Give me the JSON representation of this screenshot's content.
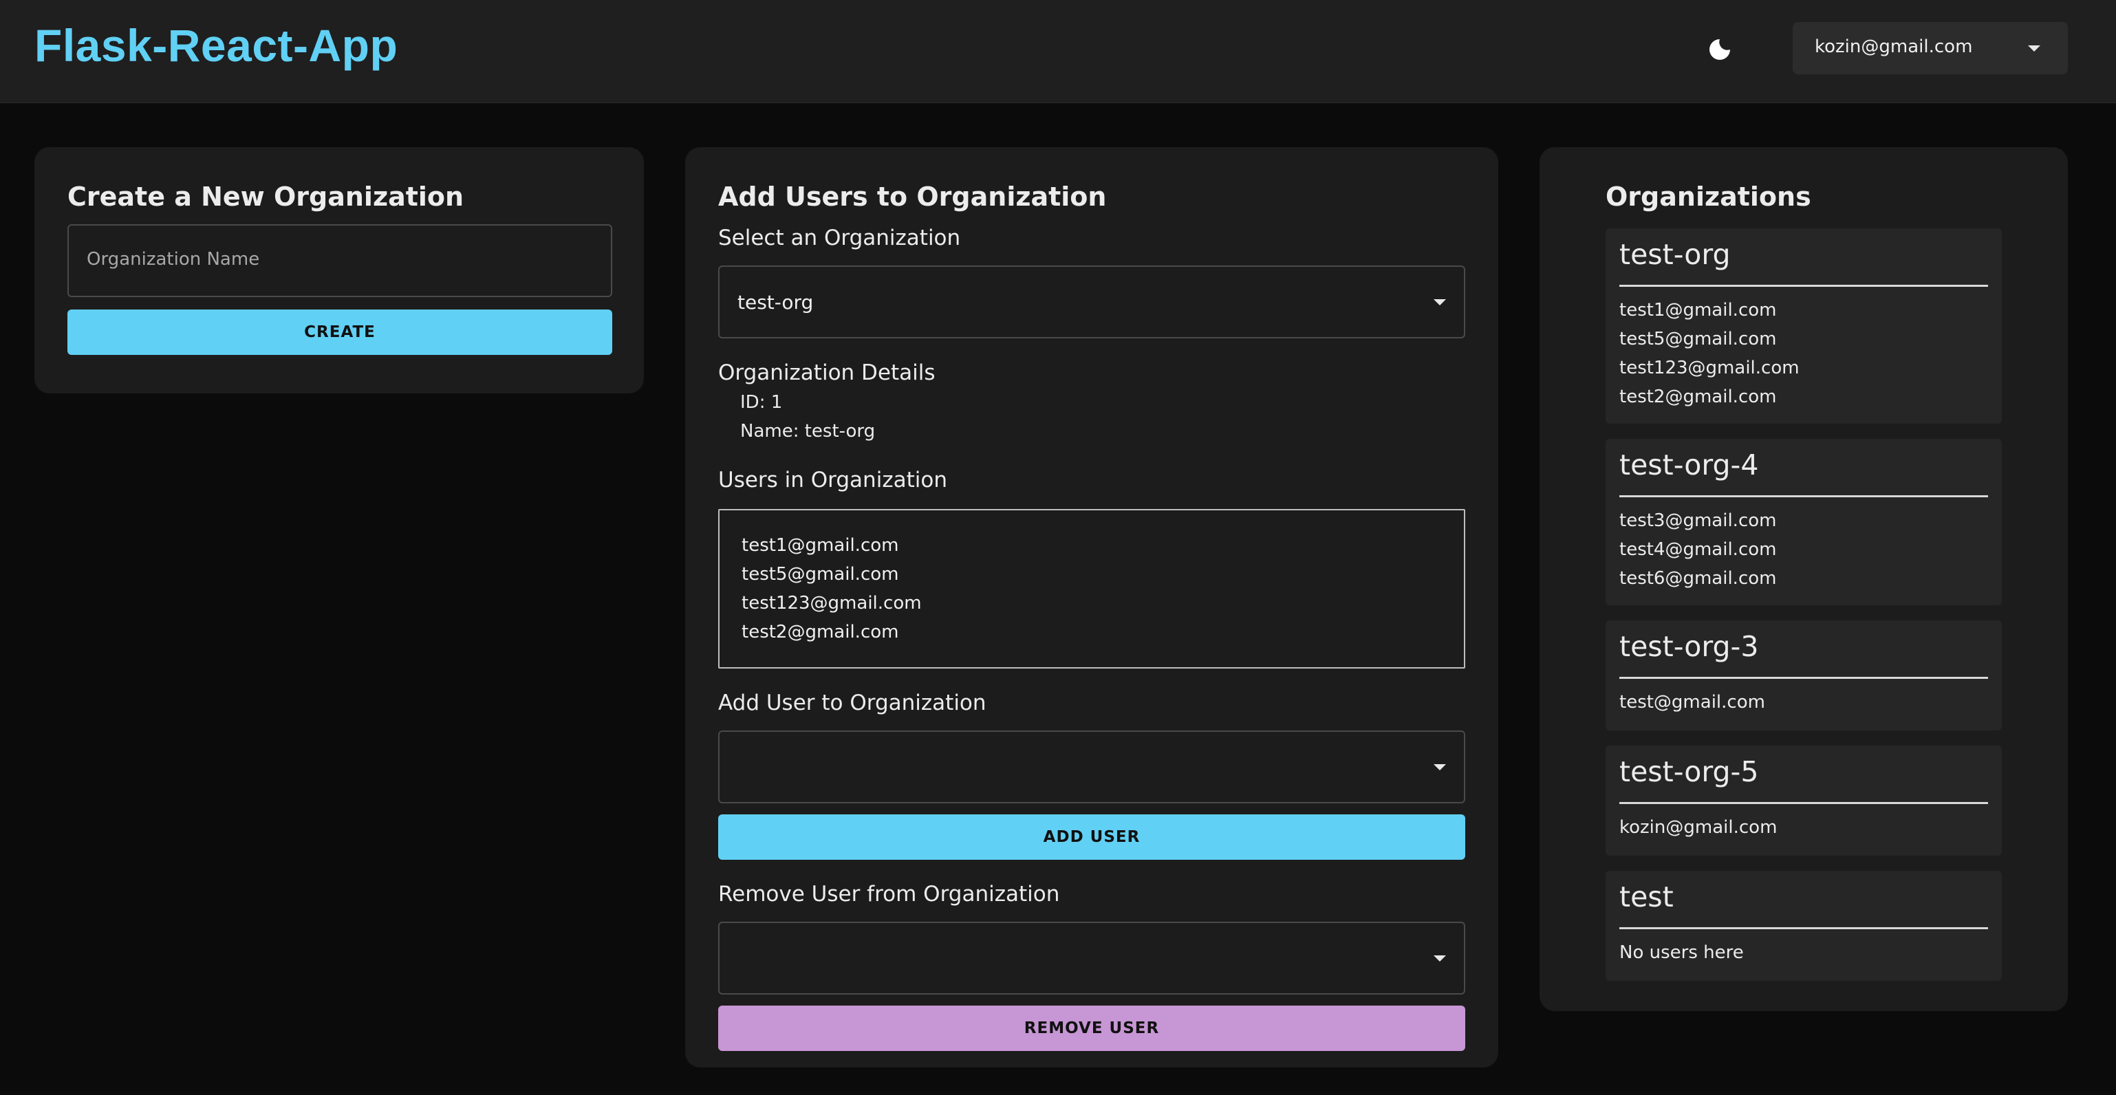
{
  "app": {
    "title": "Flask-React-App",
    "theme_icon": "moon-icon",
    "account": "kozin@gmail.com"
  },
  "create_card": {
    "title": "Create a New Organization",
    "name_placeholder": "Organization Name",
    "create_label": "CREATE"
  },
  "add_users_card": {
    "title": "Add Users to Organization",
    "select_label": "Select an Organization",
    "selected_org": "test-org",
    "details_label": "Organization Details",
    "details_id": "ID: 1",
    "details_name": "Name: test-org",
    "users_label": "Users in Organization",
    "users": [
      "test1@gmail.com",
      "test5@gmail.com",
      "test123@gmail.com",
      "test2@gmail.com"
    ],
    "add_user_label": "Add User to Organization",
    "add_user_value": "",
    "add_button": "ADD USER",
    "remove_user_label": "Remove User from Organization",
    "remove_user_value": "",
    "remove_button": "REMOVE USER"
  },
  "organizations": {
    "title": "Organizations",
    "list": [
      {
        "name": "test-org",
        "users": [
          "test1@gmail.com",
          "test5@gmail.com",
          "test123@gmail.com",
          "test2@gmail.com"
        ]
      },
      {
        "name": "test-org-4",
        "users": [
          "test3@gmail.com",
          "test4@gmail.com",
          "test6@gmail.com"
        ]
      },
      {
        "name": "test-org-3",
        "users": [
          "test@gmail.com"
        ]
      },
      {
        "name": "test-org-5",
        "users": [
          "kozin@gmail.com"
        ]
      },
      {
        "name": "test",
        "users": [
          "No users here"
        ]
      }
    ]
  },
  "colors": {
    "accent": "#61d0f5",
    "remove": "#c796d4",
    "background": "#0b0b0b",
    "card": "#1c1c1c"
  }
}
